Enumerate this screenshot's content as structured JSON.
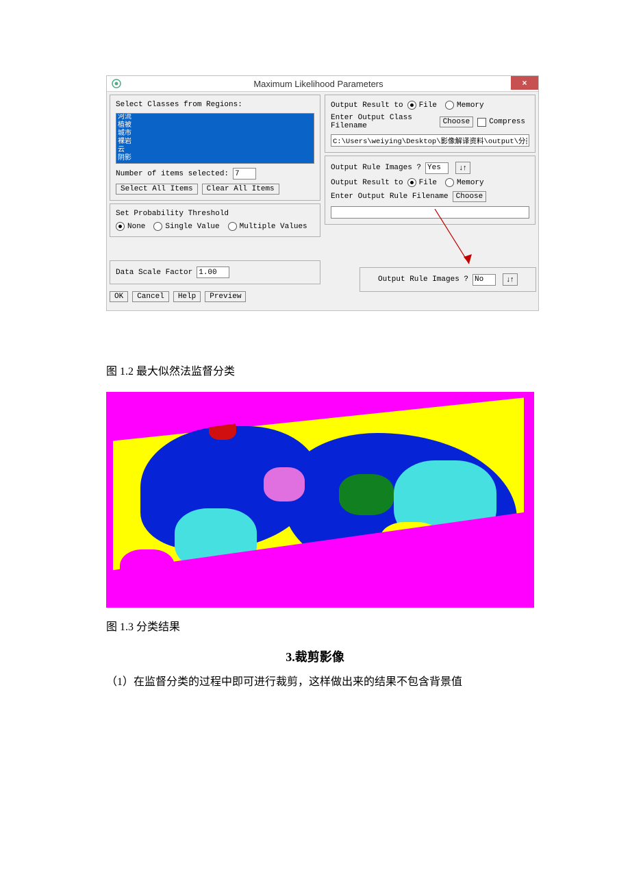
{
  "dialog": {
    "title": "Maximum Likelihood Parameters",
    "left": {
      "select_label": "Select Classes from Regions:",
      "classes": [
        "河流",
        "植被",
        "城市",
        "裸岩",
        "云",
        "阴影"
      ],
      "num_selected_label": "Number of items selected:",
      "num_selected_value": "7",
      "select_all_btn": "Select All Items",
      "clear_all_btn": "Clear All Items",
      "prob_threshold_label": "Set Probability Threshold",
      "threshold_none": "None",
      "threshold_single": "Single Value",
      "threshold_multiple": "Multiple Values",
      "data_scale_label": "Data Scale Factor",
      "data_scale_value": "1.00"
    },
    "right": {
      "output_result_to": "Output Result to",
      "opt_file": "File",
      "opt_memory": "Memory",
      "enter_class_filename": "Enter Output Class Filename",
      "choose_btn": "Choose",
      "compress_label": "Compress",
      "class_path": "C:\\Users\\weiying\\Desktop\\影像解译资料\\output\\分类影",
      "output_rule_images": "Output Rule Images ?",
      "rule_yes": "Yes",
      "enter_rule_filename": "Enter Output Rule Filename"
    },
    "float": {
      "output_rule_images": "Output Rule Images ?",
      "rule_no": "No"
    },
    "buttons": {
      "ok": "OK",
      "cancel": "Cancel",
      "help": "Help",
      "preview": "Preview"
    }
  },
  "captions": {
    "fig12": "图 1.2 最大似然法监督分类",
    "fig13": "图 1.3 分类结果"
  },
  "section3_title": "3.裁剪影像",
  "para1": "（1）在监督分类的过程中即可进行裁剪，这样做出来的结果不包含背景值"
}
